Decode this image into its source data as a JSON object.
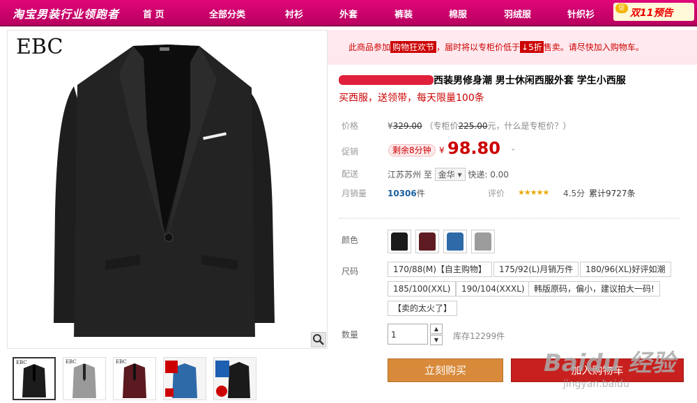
{
  "nav": {
    "brand": "淘宝男装行业领跑者",
    "items": [
      "首 页",
      "全部分类",
      "衬衫",
      "外套",
      "裤装",
      "棉服",
      "羽绒服",
      "针织衫"
    ],
    "promo_badge": "促",
    "promo_text": "双11预告"
  },
  "gallery": {
    "logo": "EBC",
    "thumb_logo": "EBC"
  },
  "notice": {
    "prefix": "此商品参加",
    "box": "购物狂欢节",
    "mid": "，届时将以专柜价低于",
    "discount": "↓5折",
    "suffix": "售卖。请尽快加入购物车。"
  },
  "product": {
    "title": "西装男修身潮 男士休闲西服外套 学生小西服",
    "subtitle": "买西服，送领带，每天限量100条"
  },
  "info": {
    "price_label": "价格",
    "price_currency": "¥",
    "price_value": "329.00",
    "price_counter_prefix": "（专柜价",
    "price_counter_value": "225.00",
    "price_counter_suffix": "元，什么是专柜价？）",
    "promo_label": "促销",
    "promo_badge": "剩余8分钟",
    "promo_currency": "¥",
    "promo_price": "98.80",
    "ship_label": "配送",
    "ship_from": "江苏苏州 至",
    "ship_to": "金华",
    "ship_fee": "快递: 0.00",
    "sales_label": "月销量",
    "sales_value": "10306",
    "sales_unit": "件",
    "rating_label": "评价",
    "rating_score": "4.5分",
    "rating_count": "累计9727条",
    "rating_stars": 4.5
  },
  "options": {
    "color_label": "颜色",
    "colors": [
      "#1b1b1b",
      "#5e1c22",
      "#2f6aa8",
      "#9c9c9c"
    ],
    "size_label": "尺码",
    "sizes": [
      "170/88(M)【自主购物】",
      "175/92(L)月销万件",
      "180/96(XL)好评如潮",
      "185/100(XXL)",
      "190/104(XXXL)",
      "韩版原码，偏小，建议拍大一码!",
      "【卖的太火了】"
    ],
    "qty_label": "数量",
    "qty_value": "1",
    "stock": "库存12299件"
  },
  "actions": {
    "buy_now": "立刻购买",
    "add_cart": "加入购物车"
  },
  "watermark": {
    "line1": "Baidu 经验",
    "line2": "jingyan.baidu"
  }
}
